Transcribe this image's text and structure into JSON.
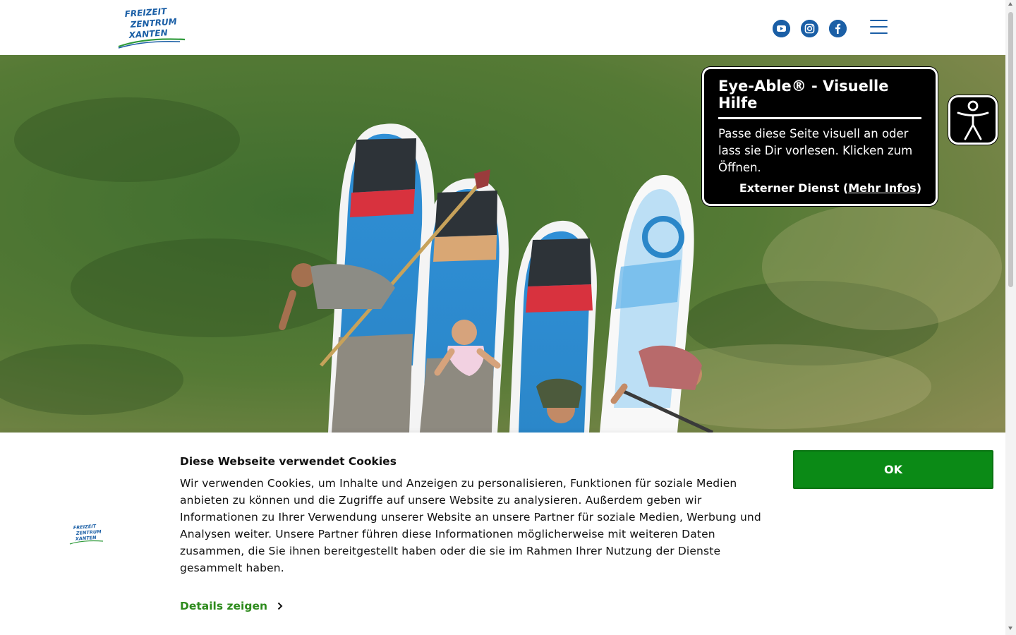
{
  "header": {
    "logo_lines": [
      "FREIZEIT",
      "ZENTRUM",
      "XANTEN"
    ],
    "social": [
      {
        "name": "youtube",
        "icon": "youtube-icon"
      },
      {
        "name": "instagram",
        "icon": "instagram-icon"
      },
      {
        "name": "facebook",
        "icon": "facebook-icon"
      }
    ],
    "menu_icon": "hamburger-menu-icon"
  },
  "hero": {
    "image": "aerial photo of four stand-up paddle boards with people on clear green water"
  },
  "eye_able": {
    "title": "Eye-Able® - Visuelle Hilfe",
    "description": "Passe diese Seite visuell an oder lass sie Dir vorlesen. Klicken zum Öffnen.",
    "external_prefix": "Externer Dienst (",
    "more_info": "Mehr Infos",
    "external_suffix": ")",
    "button_icon": "accessibility-person-icon"
  },
  "cookie_banner": {
    "title": "Diese Webseite verwendet Cookies",
    "text": "Wir verwenden Cookies, um Inhalte und Anzeigen zu personalisieren, Funktionen für soziale Medien anbieten zu können und die Zugriffe auf unsere Website zu analysieren. Außerdem geben wir Informationen zu Ihrer Verwendung unserer Website an unsere Partner für soziale Medien, Werbung und Analysen weiter. Unsere Partner führen diese Informationen möglicherweise mit weiteren Daten zusammen, die Sie ihnen bereitgestellt haben oder die sie im Rahmen Ihrer Nutzung der Dienste gesammelt haben.",
    "details_label": "Details zeigen",
    "ok_label": "OK"
  },
  "colors": {
    "brand_blue": "#1b5fa6",
    "ok_green": "#0b8a16",
    "details_green": "#2e8b1d"
  }
}
